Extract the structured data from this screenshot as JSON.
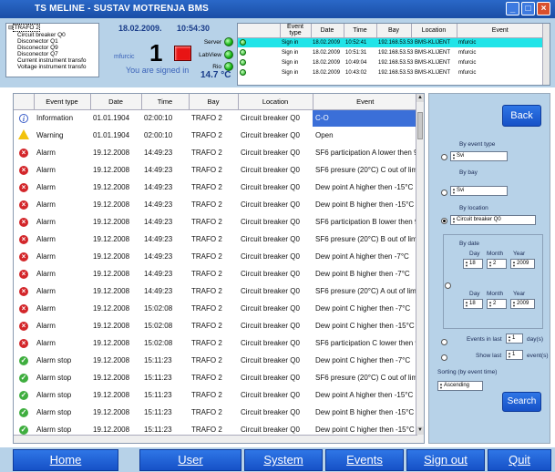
{
  "window": {
    "title": "TS MELINE  -  SUSTAV MOTRENJA BMS",
    "buttons": [
      "_",
      "□",
      "×"
    ]
  },
  "header": {
    "tree_items": [
      "TRAFO 2",
      "Circuit breaker Q0",
      "Disconector Q1",
      "Disconector Q9",
      "Disconector Q7",
      "Current instrument transfo",
      "Voltage instrument transfo"
    ],
    "date": "18.02.2009.",
    "time": "10:54:30",
    "user_label": "mfurcic",
    "signed_in": "You are signed in",
    "big_number": "1",
    "status": [
      {
        "label": "Server",
        "state": "ok"
      },
      {
        "label": "LabView",
        "state": "ok"
      },
      {
        "label": "Rio",
        "state": "ok"
      }
    ],
    "temperature": "14.7 °C"
  },
  "recent_events": {
    "columns": [
      "Event type",
      "Date",
      "Time",
      "Bay",
      "Location",
      "Event"
    ],
    "rows": [
      [
        "Sign in",
        "18.02.2009",
        "10:52:41",
        "192.168.53.53",
        "BMS-KLIJENT",
        "mfurcic"
      ],
      [
        "Sign in",
        "18.02.2009",
        "10:51:31",
        "192.168.53.53",
        "BMS-KLIJENT",
        "mfurcic"
      ],
      [
        "Sign in",
        "18.02.2009",
        "10:49:04",
        "192.168.53.53",
        "BMS-KLIJENT",
        "mfurcic"
      ],
      [
        "Sign in",
        "18.02.2009",
        "10:43:02",
        "192.168.53.53",
        "BMS-KLIJENT",
        "mfurcic"
      ]
    ]
  },
  "events": {
    "columns": [
      "",
      "Event type",
      "Date",
      "Time",
      "Bay",
      "Location",
      "Event"
    ],
    "rows": [
      {
        "icon": "info",
        "type": "Information",
        "date": "01.01.1904",
        "time": "02:00:10",
        "bay": "TRAFO 2",
        "location": "Circuit breaker Q0",
        "event": "C-O"
      },
      {
        "icon": "warning",
        "type": "Warning",
        "date": "01.01.1904",
        "time": "02:00:10",
        "bay": "TRAFO 2",
        "location": "Circuit breaker Q0",
        "event": "Open"
      },
      {
        "icon": "alarm",
        "type": "Alarm",
        "date": "19.12.2008",
        "time": "14:49:23",
        "bay": "TRAFO 2",
        "location": "Circuit breaker Q0",
        "event": "SF6 participation A lower then 90"
      },
      {
        "icon": "alarm",
        "type": "Alarm",
        "date": "19.12.2008",
        "time": "14:49:23",
        "bay": "TRAFO 2",
        "location": "Circuit breaker Q0",
        "event": "SF6 presure (20°C) C out of limits"
      },
      {
        "icon": "alarm",
        "type": "Alarm",
        "date": "19.12.2008",
        "time": "14:49:23",
        "bay": "TRAFO 2",
        "location": "Circuit breaker Q0",
        "event": "Dew point A higher then -15°C"
      },
      {
        "icon": "alarm",
        "type": "Alarm",
        "date": "19.12.2008",
        "time": "14:49:23",
        "bay": "TRAFO 2",
        "location": "Circuit breaker Q0",
        "event": "Dew point B higher then -15°C"
      },
      {
        "icon": "alarm",
        "type": "Alarm",
        "date": "19.12.2008",
        "time": "14:49:23",
        "bay": "TRAFO 2",
        "location": "Circuit breaker Q0",
        "event": "SF6 participation B lower then 90"
      },
      {
        "icon": "alarm",
        "type": "Alarm",
        "date": "19.12.2008",
        "time": "14:49:23",
        "bay": "TRAFO 2",
        "location": "Circuit breaker Q0",
        "event": "SF6 presure (20°C) B out of limits"
      },
      {
        "icon": "alarm",
        "type": "Alarm",
        "date": "19.12.2008",
        "time": "14:49:23",
        "bay": "TRAFO 2",
        "location": "Circuit breaker Q0",
        "event": "Dew point A higher then -7°C"
      },
      {
        "icon": "alarm",
        "type": "Alarm",
        "date": "19.12.2008",
        "time": "14:49:23",
        "bay": "TRAFO 2",
        "location": "Circuit breaker Q0",
        "event": "Dew point B higher then -7°C"
      },
      {
        "icon": "alarm",
        "type": "Alarm",
        "date": "19.12.2008",
        "time": "14:49:23",
        "bay": "TRAFO 2",
        "location": "Circuit breaker Q0",
        "event": "SF6 presure (20°C) A out of limits"
      },
      {
        "icon": "alarm",
        "type": "Alarm",
        "date": "19.12.2008",
        "time": "15:02:08",
        "bay": "TRAFO 2",
        "location": "Circuit breaker Q0",
        "event": "Dew point C higher then -7°C"
      },
      {
        "icon": "alarm",
        "type": "Alarm",
        "date": "19.12.2008",
        "time": "15:02:08",
        "bay": "TRAFO 2",
        "location": "Circuit breaker Q0",
        "event": "Dew point C higher then -15°C"
      },
      {
        "icon": "alarm",
        "type": "Alarm",
        "date": "19.12.2008",
        "time": "15:02:08",
        "bay": "TRAFO 2",
        "location": "Circuit breaker Q0",
        "event": "SF6 participation C lower then 90"
      },
      {
        "icon": "stop",
        "type": "Alarm stop",
        "date": "19.12.2008",
        "time": "15:11:23",
        "bay": "TRAFO 2",
        "location": "Circuit breaker Q0",
        "event": "Dew point C higher then -7°C"
      },
      {
        "icon": "stop",
        "type": "Alarm stop",
        "date": "19.12.2008",
        "time": "15:11:23",
        "bay": "TRAFO 2",
        "location": "Circuit breaker Q0",
        "event": "SF6 presure (20°C) C out of limits"
      },
      {
        "icon": "stop",
        "type": "Alarm stop",
        "date": "19.12.2008",
        "time": "15:11:23",
        "bay": "TRAFO 2",
        "location": "Circuit breaker Q0",
        "event": "Dew point A higher then -15°C"
      },
      {
        "icon": "stop",
        "type": "Alarm stop",
        "date": "19.12.2008",
        "time": "15:11:23",
        "bay": "TRAFO 2",
        "location": "Circuit breaker Q0",
        "event": "Dew point B higher then -15°C"
      },
      {
        "icon": "stop",
        "type": "Alarm stop",
        "date": "19.12.2008",
        "time": "15:11:23",
        "bay": "TRAFO 2",
        "location": "Circuit breaker Q0",
        "event": "Dew point C higher then -15°C"
      }
    ]
  },
  "filters": {
    "back": "Back",
    "by_event_type": "By event type",
    "event_type_value": "Svi",
    "by_bay": "By bay",
    "bay_value": "Svi",
    "by_location": "By location",
    "location_value": "Circuit breaker Q0",
    "by_date": "By date",
    "day": "Day",
    "month": "Month",
    "year": "Year",
    "from": {
      "day": "18",
      "month": "2",
      "year": "2009"
    },
    "to": {
      "day": "18",
      "month": "2",
      "year": "2009"
    },
    "events_in_last": "Events in last",
    "events_in_last_value": "1",
    "days_unit": "day(s)",
    "show_last": "Show last",
    "show_last_value": "1",
    "events_unit": "event(s)",
    "sorting": "Sorting (by event time)",
    "sorting_value": "Ascending",
    "search": "Search"
  },
  "nav": [
    "Home",
    "User",
    "System",
    "Events",
    "Sign out",
    "Quit"
  ]
}
